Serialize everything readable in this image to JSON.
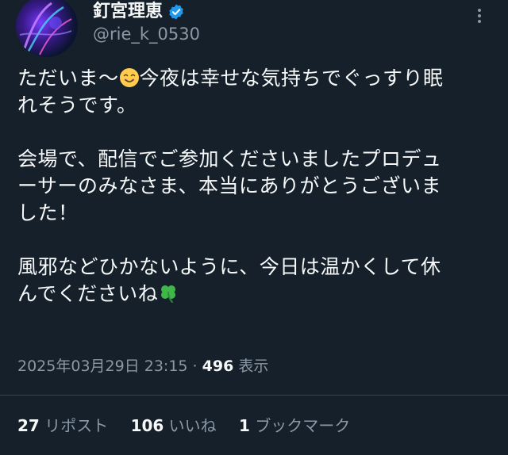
{
  "author": {
    "display_name": "釘宮理恵",
    "handle": "@rie_k_0530",
    "verified_icon": "verified-badge-icon"
  },
  "tweet": {
    "line1_before_emoji": "ただいま〜",
    "line1_emoji": "😊",
    "line1_after_emoji": "今夜は幸せな気持ちでぐっすり眠",
    "line2": "れそうです。",
    "para2": "会場で、配信でご参加くださいましたプロデュ\nーサーのみなさま、本当にありがとうございま\nした！",
    "para3_main": "風邪などひかないように、今日は温かくして休\nんでくださいね",
    "para3_emoji": "🍀"
  },
  "meta": {
    "timestamp": "2025年03月29日 23:15",
    "separator": " · ",
    "views_count": "496",
    "views_label": " 表示"
  },
  "stats": {
    "retweets_count": "27",
    "retweets_label": "リポスト",
    "likes_count": "106",
    "likes_label": "いいね",
    "bookmarks_count": "1",
    "bookmarks_label": "ブックマーク"
  },
  "colors": {
    "background": "#15202b",
    "text": "#f7f9f9",
    "secondary": "#8b98a5",
    "verified": "#1d9bf0"
  }
}
